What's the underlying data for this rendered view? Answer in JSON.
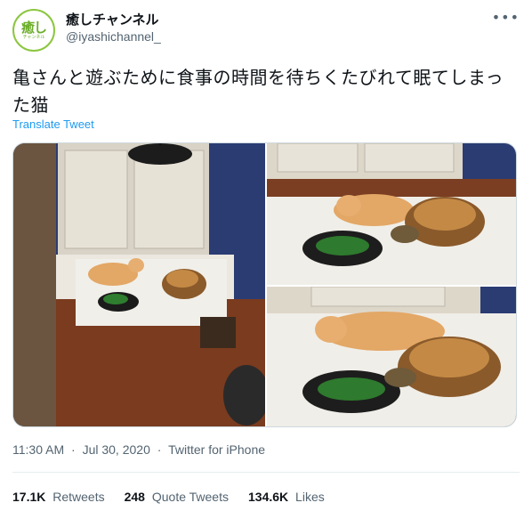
{
  "user": {
    "display_name": "癒しチャンネル",
    "handle": "@iyashichannel_",
    "avatar_text": "癒し",
    "avatar_subtext": "チャンネル"
  },
  "tweet": {
    "text": "亀さんと遊ぶために食事の時間を待ちくたびれて眠てしまった猫",
    "translate_label": "Translate Tweet",
    "time": "11:30 AM",
    "date": "Jul 30, 2020",
    "source": "Twitter for iPhone",
    "separator": "·",
    "more_icon": "more-icon"
  },
  "stats": {
    "retweets_count": "17.1K",
    "retweets_label": "Retweets",
    "quotes_count": "248",
    "quotes_label": "Quote Tweets",
    "likes_count": "134.6K",
    "likes_label": "Likes"
  },
  "colors": {
    "accent": "#1d9bf0",
    "secondary_text": "#536471",
    "avatar_green": "#6cae2a"
  }
}
